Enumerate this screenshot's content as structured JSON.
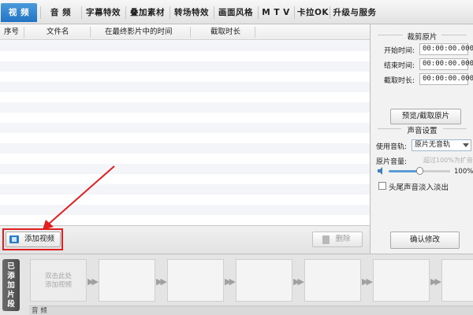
{
  "tabs": [
    {
      "label": "视 频",
      "active": true
    },
    {
      "label": "音 频",
      "active": false
    },
    {
      "label": "字幕特效",
      "active": false
    },
    {
      "label": "叠加素材",
      "active": false
    },
    {
      "label": "转场特效",
      "active": false
    },
    {
      "label": "画面风格",
      "active": false
    },
    {
      "label": "M T V",
      "active": false
    },
    {
      "label": "卡拉OK",
      "active": false
    },
    {
      "label": "升级与服务",
      "active": false
    }
  ],
  "list": {
    "columns": [
      "序号",
      "文件名",
      "在最终影片中的时间",
      "截取时长"
    ]
  },
  "left_toolbar": {
    "add_video_label": "添加视频",
    "delete_label": "删除"
  },
  "trim": {
    "title": "裁剪原片",
    "start_label": "开始时间:",
    "start_value": "00:00:00.000",
    "end_label": "结束时间:",
    "end_value": "00:00:00.000",
    "duration_label": "截取时长:",
    "duration_value": "00:00:00.000",
    "preview_button": "预览/截取原片"
  },
  "sound": {
    "title": "声音设置",
    "track_label": "使用音轨:",
    "track_value": "原片无音轨",
    "volume_label": "原片音量:",
    "volume_hint": "超过100%为扩音",
    "volume_percent": "100%",
    "volume_fraction": 0.5,
    "fade_label": "头尾声音淡入淡出",
    "fade_checked": false
  },
  "confirm_button": "确认修改",
  "timeline": {
    "side_tab_chars": [
      "已",
      "添",
      "加",
      "片",
      "段"
    ],
    "placeholder_line1": "双击此处",
    "placeholder_line2": "添加视频",
    "audio_label": "音 频"
  },
  "colors": {
    "active_tab": "#2a7ccc",
    "highlight": "#e02020",
    "slider": "#5b9bd5"
  }
}
